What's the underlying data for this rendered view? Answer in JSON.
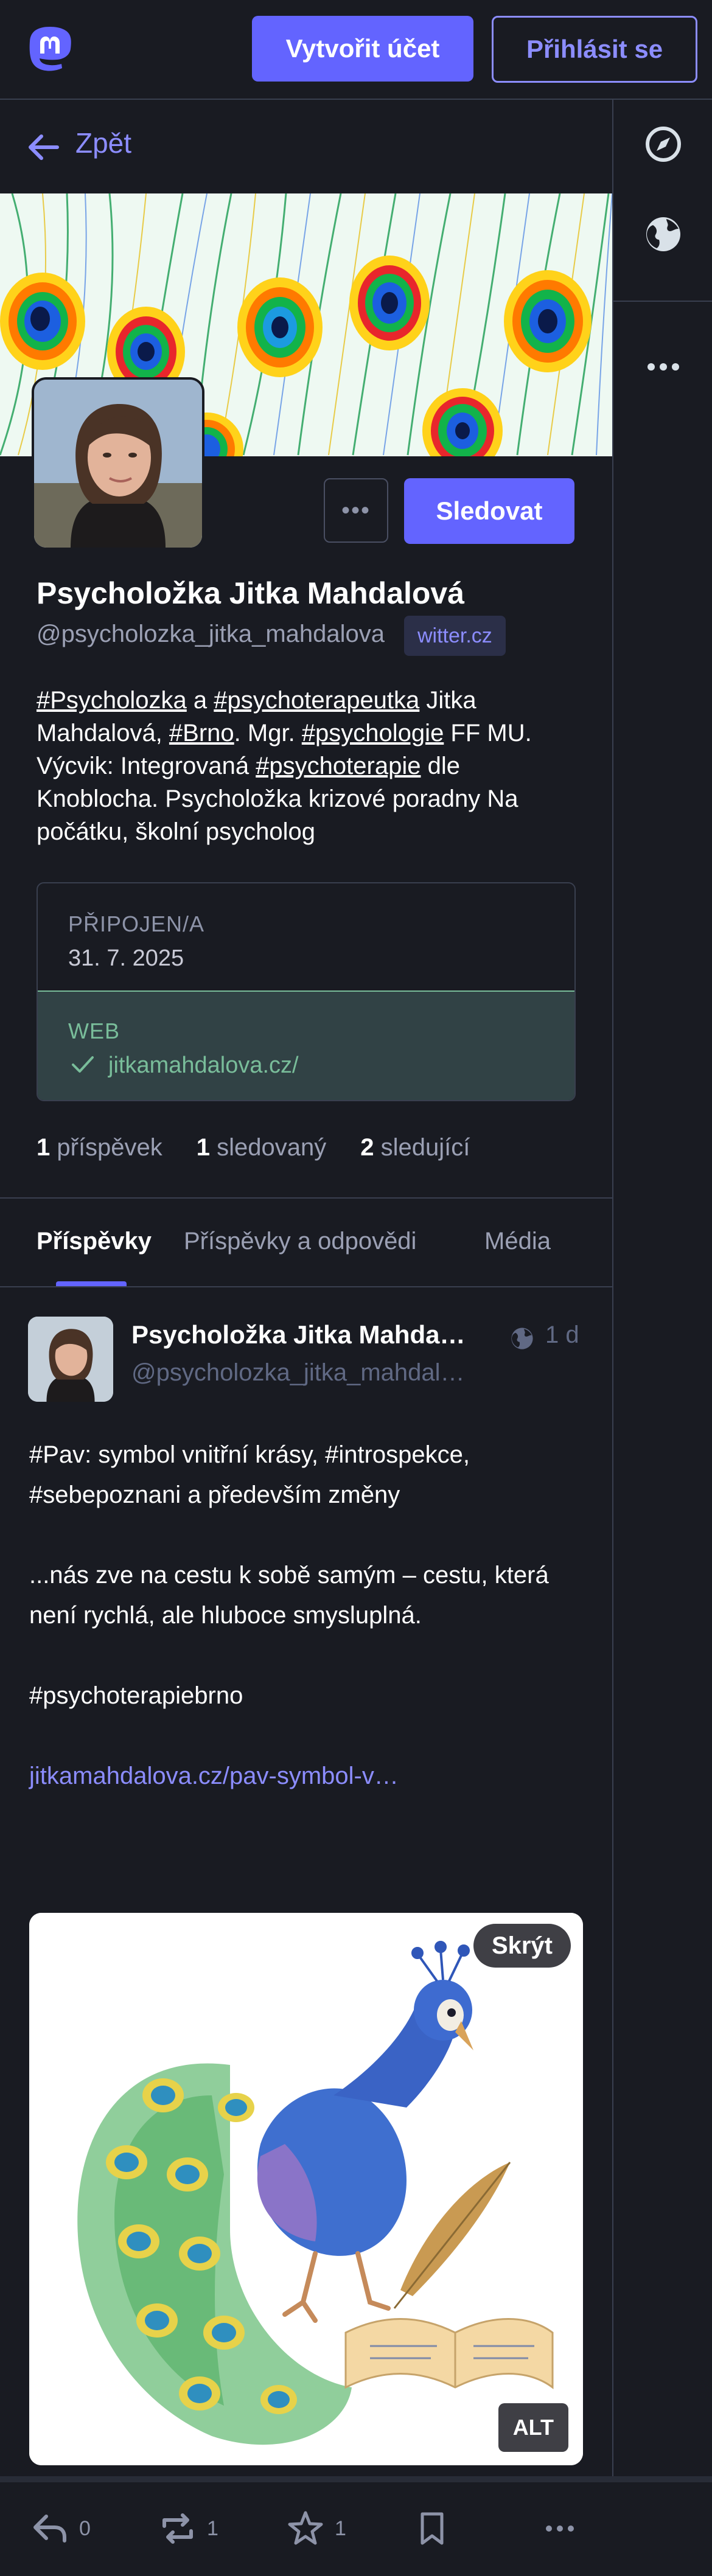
{
  "topbar": {
    "signup_label": "Vytvořit účet",
    "login_label": "Přihlásit se"
  },
  "nav": {
    "back_label": "Zpět"
  },
  "profile": {
    "display_name": "Psycholožka Jitka Mahdalová",
    "handle": "@psycholozka_jitka_mahdalova",
    "domain": "witter.cz",
    "more_label": "•••",
    "follow_label": "Sledovat",
    "bio": {
      "tag1": "#Psycholozka",
      "t1": " a ",
      "tag2": "#psychoterapeutka",
      "t2": " Jitka Mahdalová, ",
      "tag3": "#Brno",
      "t3": ". Mgr. ",
      "tag4": "#psychologie",
      "t4": " FF MU. Výcvik: Integrovaná ",
      "tag5": "#psychoterapie",
      "t5": " dle Knoblocha. Psycholožka krizové poradny Na počátku, školní psycholog"
    },
    "fields": {
      "joined_label": "PŘIPOJEN/A",
      "joined_value": "31. 7. 2025",
      "web_label": "WEB",
      "web_value": "jitkamahdalova.cz/"
    },
    "stats": {
      "posts_count": "1",
      "posts_label": "příspěvek",
      "following_count": "1",
      "following_label": "sledovaný",
      "followers_count": "2",
      "followers_label": "sledující"
    }
  },
  "tabs": [
    {
      "label": "Příspěvky"
    },
    {
      "label": "Příspěvky a odpovědi"
    },
    {
      "label": "Média"
    }
  ],
  "post": {
    "author_name": "Psycholožka Jitka Mahdalová",
    "author_handle": "@psycholozka_jitka_mahdalova@witter.cz",
    "time": "1 d",
    "para1": "#Pav: symbol vnitřní krásy, #introspekce, #sebepoznani a především změny",
    "para2": "...nás zve na cestu k sobě samým – cestu, která není rychlá, ale hluboce smysluplná.",
    "para3": "#psychoterapiebrno",
    "link": "jitkamahdalova.cz/pav-symbol-v…",
    "media_hide_label": "Skrýt",
    "media_alt_label": "ALT",
    "replies": "0",
    "boosts": "1",
    "favourites": "1"
  },
  "colors": {
    "background": "#191b22",
    "accent": "#6364ff",
    "accent_light": "#8c8dff",
    "verified_green": "#79bd9a",
    "muted": "#606984"
  },
  "icons": [
    "mastodon-logo",
    "back-arrow-icon",
    "compass-icon",
    "globe-icon",
    "ellipsis-icon",
    "check-icon",
    "reply-icon",
    "boost-icon",
    "star-icon",
    "bookmark-icon"
  ]
}
